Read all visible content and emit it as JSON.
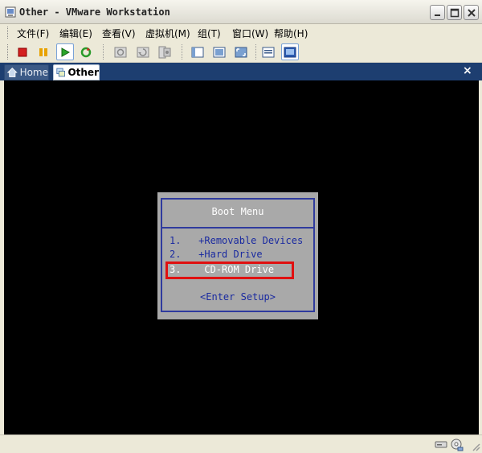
{
  "window": {
    "title": "Other - VMware Workstation"
  },
  "menu": [
    {
      "label": "文件(F)"
    },
    {
      "label": "编辑(E)"
    },
    {
      "label": "查看(V)"
    },
    {
      "label": "虚拟机(M)"
    },
    {
      "label": "组(T)"
    },
    {
      "label": "窗口(W)"
    },
    {
      "label": "帮助(H)"
    }
  ],
  "toolbar": {
    "icons": [
      "stop-icon",
      "pause-icon",
      "play-icon",
      "reset-icon",
      "snapshot-icon",
      "revert-snapshot-icon",
      "snapshot-manager-icon",
      "normal-view-icon",
      "quick-switch-icon",
      "fullscreen-icon",
      "summary-view-icon",
      "console-view-icon"
    ]
  },
  "tabs": [
    {
      "label": "Home",
      "icon": "home-icon"
    },
    {
      "label": "Other",
      "icon": "vm-icon"
    }
  ],
  "close_tab": "×",
  "boot_menu": {
    "title": "Boot Menu",
    "options": [
      {
        "number": "1.",
        "label": "+Removable Devices",
        "selected": false
      },
      {
        "number": "2.",
        "label": "+Hard Drive",
        "selected": false
      },
      {
        "number": "3.",
        "label": "CD-ROM Drive",
        "selected": true
      }
    ],
    "enter_setup": "<Enter Setup>"
  },
  "colors": {
    "tab_strip": "#1d3e70",
    "boot_bg": "#a9a9a9",
    "boot_text": "#1a2aa0",
    "highlight": "#e01010"
  }
}
